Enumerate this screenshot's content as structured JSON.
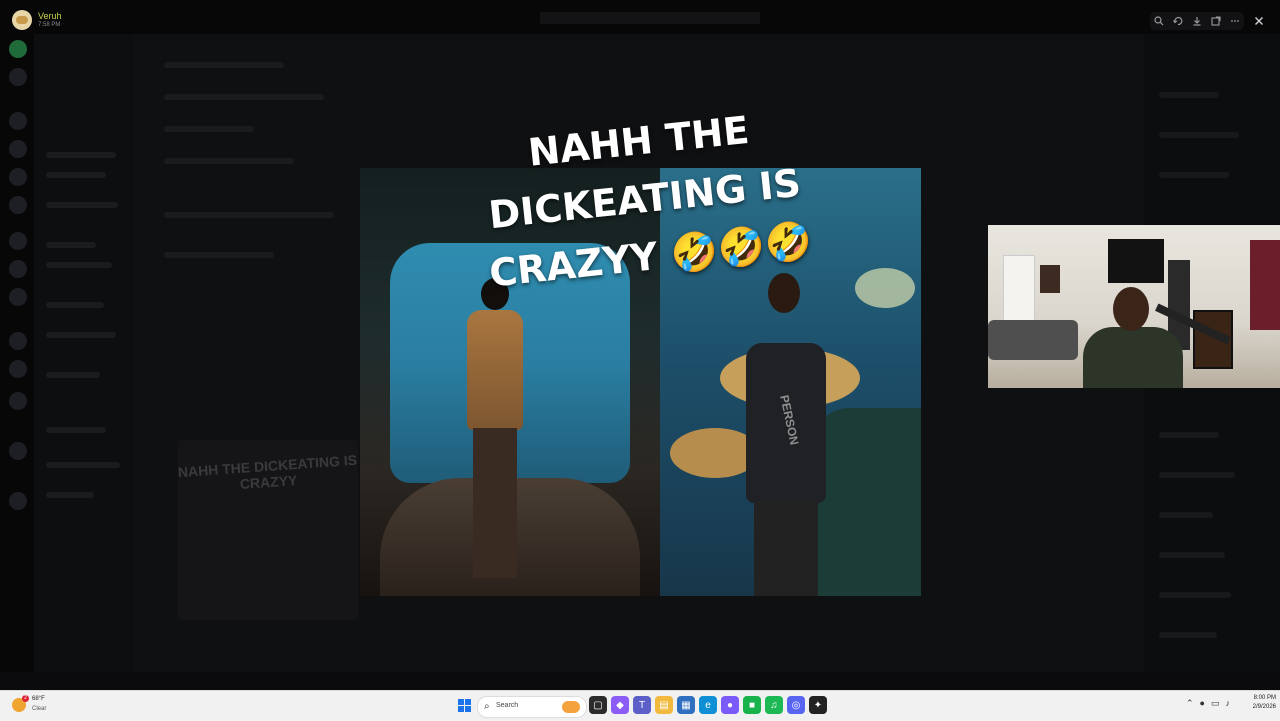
{
  "viewer": {
    "user_name": "Veruh",
    "timestamp": "7:58 PM",
    "close_icon": "close-icon",
    "tools": [
      "zoom-icon",
      "rotate-icon",
      "download-icon",
      "open-external-icon",
      "more-icon"
    ]
  },
  "media": {
    "caption_line1": "NAHH THE",
    "caption_line2": "DICKEATING IS",
    "caption_line3": "CRAZYY",
    "caption_emojis": "🤣🤣🤣",
    "shirt_print": "PERSON"
  },
  "background_thumbnail": {
    "caption": "NAHH THE DICKEATING IS CRAZYY"
  },
  "taskbar": {
    "weather_temp": "68°F",
    "weather_condition": "Clear",
    "weather_badge": "2",
    "search_placeholder": "Search",
    "time": "8:00 PM",
    "date": "2/9/2026",
    "accent_color": "#1a73e8"
  }
}
